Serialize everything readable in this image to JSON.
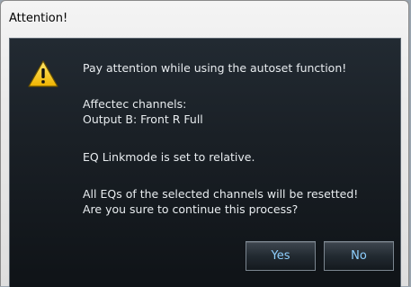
{
  "dialog": {
    "title": "Attention!",
    "icon": "warning-triangle-icon",
    "message": {
      "line1": "Pay attention while using the autoset function!",
      "line2": "Affectec channels:",
      "line3": "Output B: Front R Full",
      "line4": "EQ Linkmode is set to relative.",
      "line5": "All EQs of the selected channels will be resetted!",
      "line6": "Are you sure to continue this process?"
    },
    "buttons": {
      "yes_label": "Yes",
      "no_label": "No"
    }
  },
  "colors": {
    "panel_background": "#1a2026",
    "text": "#e8ecef",
    "button_text": "#8fd0ff",
    "warning_fill": "#f5c400"
  }
}
